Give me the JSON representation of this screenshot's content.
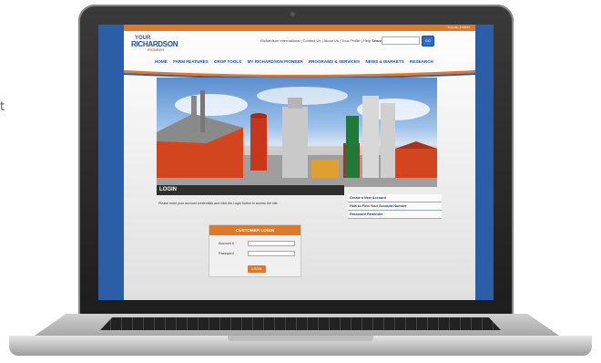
{
  "side_text": "t",
  "site": {
    "date": "Thursday 17/06/11",
    "logo": {
      "line1": "YOUR",
      "line2": "RICHARDSON",
      "line3": "PIONEER"
    },
    "top_links": "Richardson International | Contact Us | About Us | Your Profile | Help",
    "search_label": "Search",
    "search_button": "GO",
    "nav": [
      "HOME",
      "FARM FEATURES",
      "CROP TOOLS",
      "MY RICHARDSON PIONEER",
      "PROGRAMS & SERVICES",
      "NEWS & MARKETS",
      "RESEARCH"
    ],
    "login_title": "LOGIN",
    "instructions": "Please enter your account credentials and click the Login button to access the site.",
    "side_links": [
      "Create a New Account",
      "How to Find Your Account Number",
      "Password Reminder"
    ],
    "login_box": {
      "header": "CUSTOMER LOGIN",
      "account_label": "Account #",
      "password_label": "Password",
      "button": "LOGIN"
    }
  },
  "colors": {
    "brand_blue": "#1f4f99",
    "accent_orange": "#e0782a",
    "bg_blue": "#2b5ea7"
  }
}
